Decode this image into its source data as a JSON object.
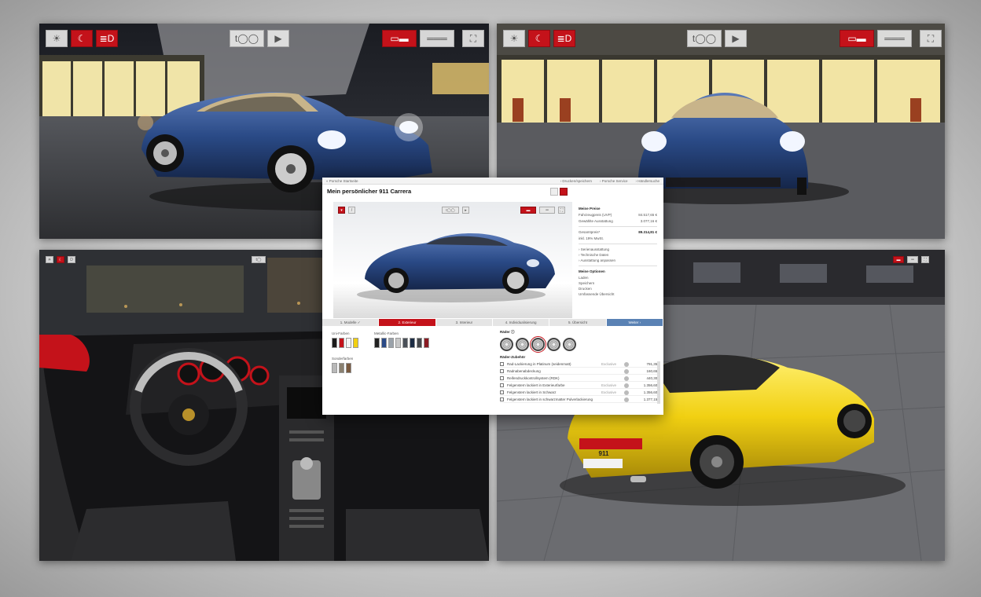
{
  "colors": {
    "accent_red": "#c4121a",
    "paint_blue": "#2a4a86",
    "paint_yellow": "#f1d012",
    "tab_blue": "#5a82b4"
  },
  "panels": {
    "top_left": {
      "toolbar_icons": [
        "sun-icon",
        "moon-icon",
        "headlight-icon",
        "camera-icon",
        "play-icon",
        "car-exterior-icon",
        "car-interior-icon",
        "fullscreen-icon"
      ]
    },
    "top_right": {
      "toolbar_icons": [
        "sun-icon",
        "moon-icon",
        "headlight-icon",
        "camera-icon",
        "play-icon",
        "car-exterior-icon",
        "car-interior-icon",
        "fullscreen-icon"
      ]
    },
    "bottom_left": {
      "scene": "interior-cockpit"
    },
    "bottom_right": {
      "scene": "yellow-911-rear",
      "plate_text": "911"
    }
  },
  "configurator": {
    "breadcrumb": "« Porsche Startseite",
    "top_links": [
      "› Drucken/speichern",
      "› Porsche Service",
      "› Händlersuche"
    ],
    "title": "Mein persönlicher 911 Carrera",
    "side": {
      "price_heading": "Meine Preise",
      "rows": [
        {
          "label": "Fahrzeugpreis (UVP)",
          "value": "84.517,65 €"
        },
        {
          "label": "Gewählte Ausstattung",
          "value": "3.077,16 €"
        }
      ],
      "total_label": "Gesamtpreis*",
      "total_value": "89.314,81 €",
      "total_note": "inkl. 19% MwSt.",
      "links": [
        "› Serienausstattung",
        "› Technische Daten",
        "› Ausstattung anpassen"
      ],
      "options_heading": "Meine Optionen",
      "options": [
        "Laden",
        "Speichern",
        "Drucken",
        "Umfassende Übersicht"
      ]
    },
    "tabs": [
      {
        "label": "1. Modelle ✓",
        "state": "done"
      },
      {
        "label": "2. Exterieur",
        "state": "active"
      },
      {
        "label": "3. Interieur",
        "state": "todo"
      },
      {
        "label": "4. Individualisierung",
        "state": "todo"
      },
      {
        "label": "5. Übersicht",
        "state": "todo"
      },
      {
        "label": "Weiter ›",
        "state": "next"
      }
    ],
    "exterior": {
      "solid_label": "Uni-Farben",
      "metallic_label": "Metallic-Farben",
      "special_label": "Sonderfarben",
      "wheels_label": "Räder ⓘ",
      "options_label": "Räder-Zubehör",
      "solid_colors": [
        "#1a1a1a",
        "#c4121a",
        "#f4f4f4",
        "#f1d012"
      ],
      "metallic_colors": [
        "#222222",
        "#2a4a86",
        "#9aa2aa",
        "#c8c8c8",
        "#4a5058",
        "#1c2c44",
        "#44474b",
        "#8a1a22"
      ],
      "special_colors": [
        "#b8b8b8",
        "#8a8070",
        "#7a5a40"
      ],
      "option_rows": [
        {
          "label": "Rad-Lackierung in Platinum (seidenmatt)",
          "tag": "Exclusive",
          "price": "791,35 €"
        },
        {
          "label": "Radnabenabdeckung",
          "tag": "",
          "price": "160,65 €"
        },
        {
          "label": "Reifendruckkontrollsystem (RDK)",
          "tag": "",
          "price": "440,30 €"
        },
        {
          "label": "Felgenstern lackiert in Exterieurfarbe",
          "tag": "Exclusive",
          "price": "1.356,60 €"
        },
        {
          "label": "Felgenstern lackiert in Schwarz",
          "tag": "Exclusive",
          "price": "1.356,60 €"
        },
        {
          "label": "Felgenstern lackiert in schwarzmatter Pulverlackierung",
          "tag": "",
          "price": "1.377,15 €"
        }
      ]
    },
    "stage": {
      "camera_label": "t◯◯",
      "toolbar_icons": [
        "headlight-icon",
        "brush-icon",
        "camera-icon",
        "play-icon",
        "car-exterior-icon",
        "car-interior-icon",
        "fullscreen-icon"
      ]
    }
  }
}
